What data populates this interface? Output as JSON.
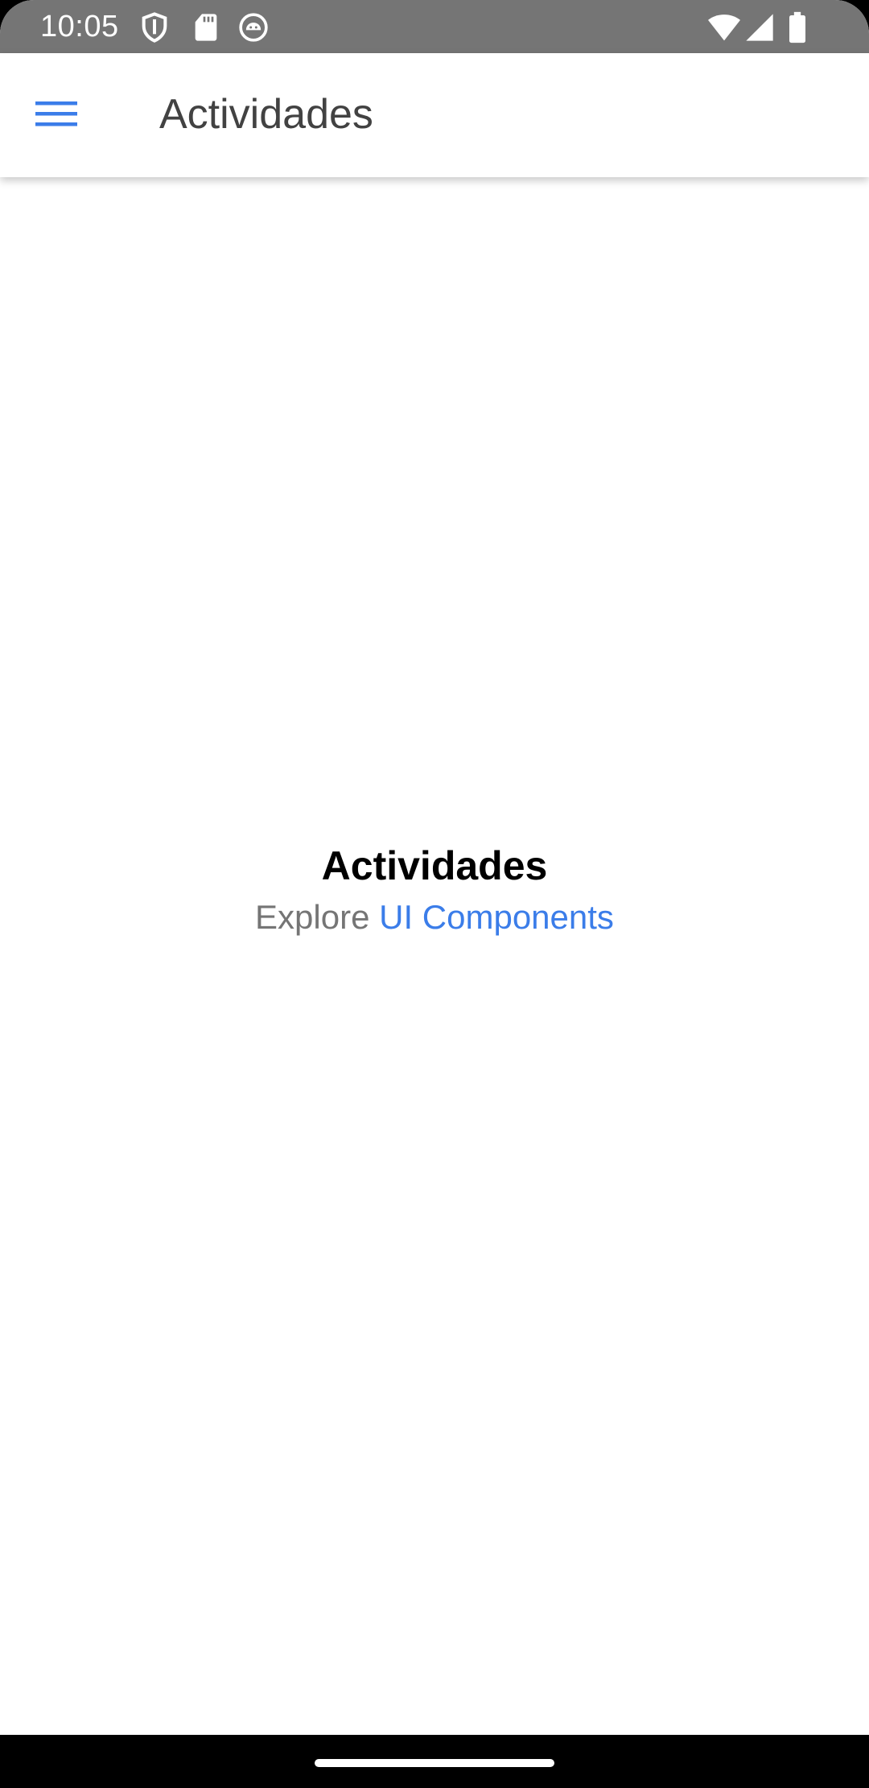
{
  "status_bar": {
    "time": "10:05",
    "left_icons": [
      "shield-icon",
      "sd-card-icon",
      "android-debug-icon"
    ],
    "right_icons": [
      "wifi-icon",
      "signal-icon",
      "battery-icon"
    ]
  },
  "app_bar": {
    "menu_icon": "menu-icon",
    "title": "Actividades"
  },
  "content": {
    "title": "Actividades",
    "subtitle_prefix": "Explore ",
    "subtitle_link": "UI Components"
  },
  "colors": {
    "accent": "#3b7de9",
    "status_bar": "#757575",
    "title_text": "#424242",
    "secondary_text": "#757575"
  }
}
